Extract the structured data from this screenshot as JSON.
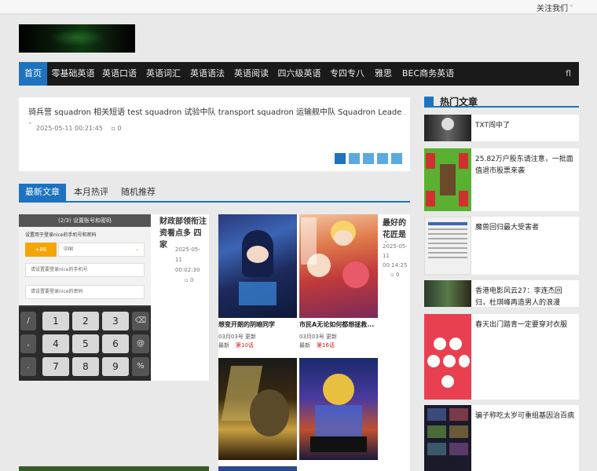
{
  "topbar": {
    "follow_label": "关注我们",
    "follow_caret": "˅"
  },
  "nav": {
    "items": [
      {
        "label": "首页"
      },
      {
        "label": "零基础英语"
      },
      {
        "label": "英语口语"
      },
      {
        "label": "英语词汇"
      },
      {
        "label": "英语语法"
      },
      {
        "label": "英语阅读"
      },
      {
        "label": "四六级英语"
      },
      {
        "label": "专四专八"
      },
      {
        "label": "雅思"
      },
      {
        "label": "BEC商务英语"
      }
    ],
    "search_glyph": "fl"
  },
  "slider": {
    "title": "骑兵营   squadron 相关短语   test squadron 试验中队  transport squadron 运输舰中队 Squadron Leade ...",
    "date": "2025-05-11 00:21:45",
    "comments": "0",
    "comment_icon": "comment-icon",
    "dots": 5,
    "active_dot": 0
  },
  "tabs": [
    {
      "label": "最新文章"
    },
    {
      "label": "本月热评"
    },
    {
      "label": "随机推荐"
    }
  ],
  "big_post": {
    "title": "财政部领衔注资看点多 四家",
    "date": "2025-05-11 00:02:30",
    "comments": "0",
    "phone": {
      "header": "(2/3) 设置账号和密码",
      "line1": "设置用于登录nice的手机号和密码",
      "code": "+86",
      "region": "中国",
      "input1": "请设置要登录nice的手机号",
      "input2": "请设置要登录nice的密码",
      "keys": [
        "1",
        "2",
        "3",
        "4",
        "5",
        "6",
        "7",
        "8",
        "9"
      ]
    }
  },
  "grid_post": {
    "side_title": "最好的花匠是",
    "side_date": "2025-05-11 00:14:25",
    "side_comments": "0",
    "comics": [
      {
        "title": "想变开朗的阴暗同学",
        "date": "03月03号 更新",
        "tag": "最新",
        "chapter": "第10话"
      },
      {
        "title": "市民A无论如何都想拯救...",
        "date": "03月03号 更新",
        "tag": "最新",
        "chapter": "第16话"
      }
    ]
  },
  "hot": {
    "heading": "热门文章",
    "items": [
      {
        "title": "TXT闯中了"
      },
      {
        "title": "25.82万户股东请注意，一批面值退市股票来袭"
      },
      {
        "title": "魔兽回归最大受害者"
      },
      {
        "title": "香港电影风云27：李连杰回归，杜琪峰再造男人的浪漫"
      },
      {
        "title": "春天出门踏青一定要穿对衣服"
      },
      {
        "title": "骗子称吃太岁可重组基因治百病"
      }
    ]
  }
}
